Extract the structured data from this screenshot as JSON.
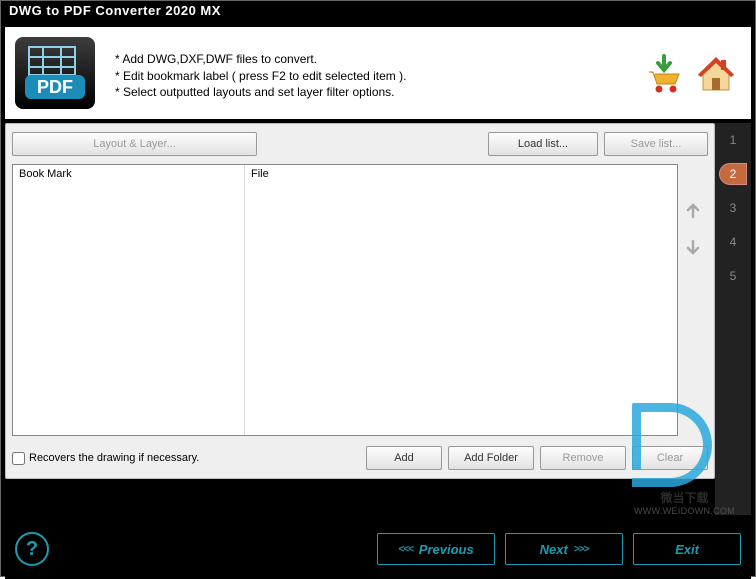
{
  "title": "DWG to PDF Converter 2020 MX",
  "instructions": {
    "line1": "* Add DWG,DXF,DWF files to convert.",
    "line2": "* Edit bookmark label ( press F2 to edit selected item ).",
    "line3": "* Select outputted layouts and set layer filter options."
  },
  "toolbar": {
    "layout_layer": "Layout & Layer...",
    "load_list": "Load list...",
    "save_list": "Save list..."
  },
  "columns": {
    "bookmark": "Book Mark",
    "file": "File"
  },
  "steps": {
    "s1": "1",
    "s2": "2",
    "s3": "3",
    "s4": "4",
    "s5": "5"
  },
  "bottom": {
    "recover_label": "Recovers the drawing if necessary.",
    "add": "Add",
    "add_folder": "Add Folder",
    "remove": "Remove",
    "clear": "Clear"
  },
  "footer": {
    "help": "?",
    "prev_arrows": "<<<",
    "prev": "Previous",
    "next": "Next",
    "next_arrows": ">>>",
    "exit": "Exit"
  },
  "watermark": {
    "text": "微当下载",
    "url": "WWW.WEIDOWN.COM"
  },
  "logo": {
    "pdf_text": "PDF"
  }
}
